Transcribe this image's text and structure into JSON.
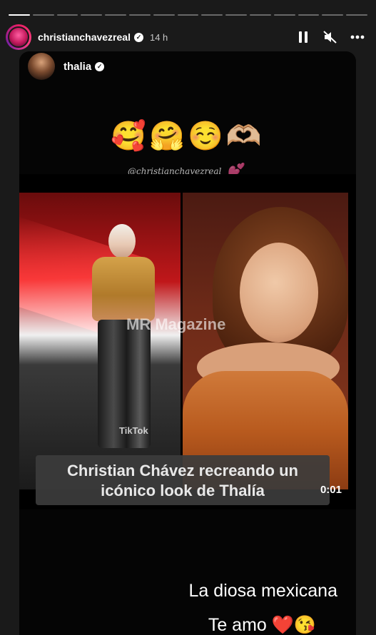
{
  "story": {
    "segments": 15,
    "active_segment": 0
  },
  "header": {
    "username": "christianchavezreal",
    "time": "14 h",
    "pause_label": "pause",
    "mute_label": "muted",
    "more_label": "more"
  },
  "repost": {
    "username": "thalia",
    "emojis": "🥰🤗☺️🫶🏼",
    "handle_watermark": "@christianchavezreal",
    "heart": "💕"
  },
  "video": {
    "watermark": "MR Magazine",
    "platform_mark": "TikTok",
    "caption_line_1": "Christian Chávez recreando un",
    "caption_line_2": "icónico look de Thalía",
    "duration": "0:01"
  },
  "note": {
    "line_1": "La diosa mexicana",
    "line_2": "Te amo ❤️😘"
  },
  "colors": {
    "background": "#1a1a1a",
    "card": "#050505",
    "accent_pink": "#e91e63"
  }
}
